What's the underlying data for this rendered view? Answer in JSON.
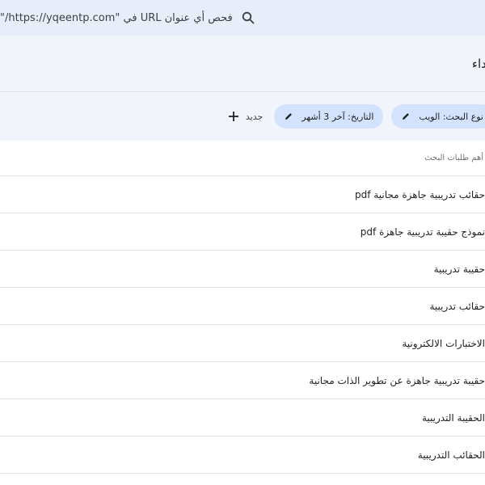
{
  "search": {
    "text": "فحص أي عنوان URL في \"https://yqeentp.com/\"",
    "icon": "search-icon"
  },
  "title": {
    "text": "اداء"
  },
  "filters": {
    "chips": [
      {
        "label": "نوع البحث: الويب",
        "icon": "edit-icon"
      },
      {
        "label": "التاريخ: آخر 3 أشهر",
        "icon": "edit-icon"
      }
    ],
    "new_label": "جديد",
    "new_icon": "plus-icon"
  },
  "list": {
    "header": "أهم طلبات البحث",
    "items": [
      "حقائب تدريبية جاهزة مجانية pdf",
      "نموذج حقيبة تدريبية جاهزة pdf",
      "حقيبة تدريبية",
      "حقائب تدريبية",
      "الاختبارات الالكترونية",
      "حقيبة تدريبية جاهزة عن تطوير الذات مجانية",
      "الحقيبة التدريبية",
      "الحقائب التدريبية"
    ]
  },
  "colors": {
    "topbar": "#e8eef9",
    "band": "#f1f4fa",
    "chip": "#d3e3fd"
  }
}
